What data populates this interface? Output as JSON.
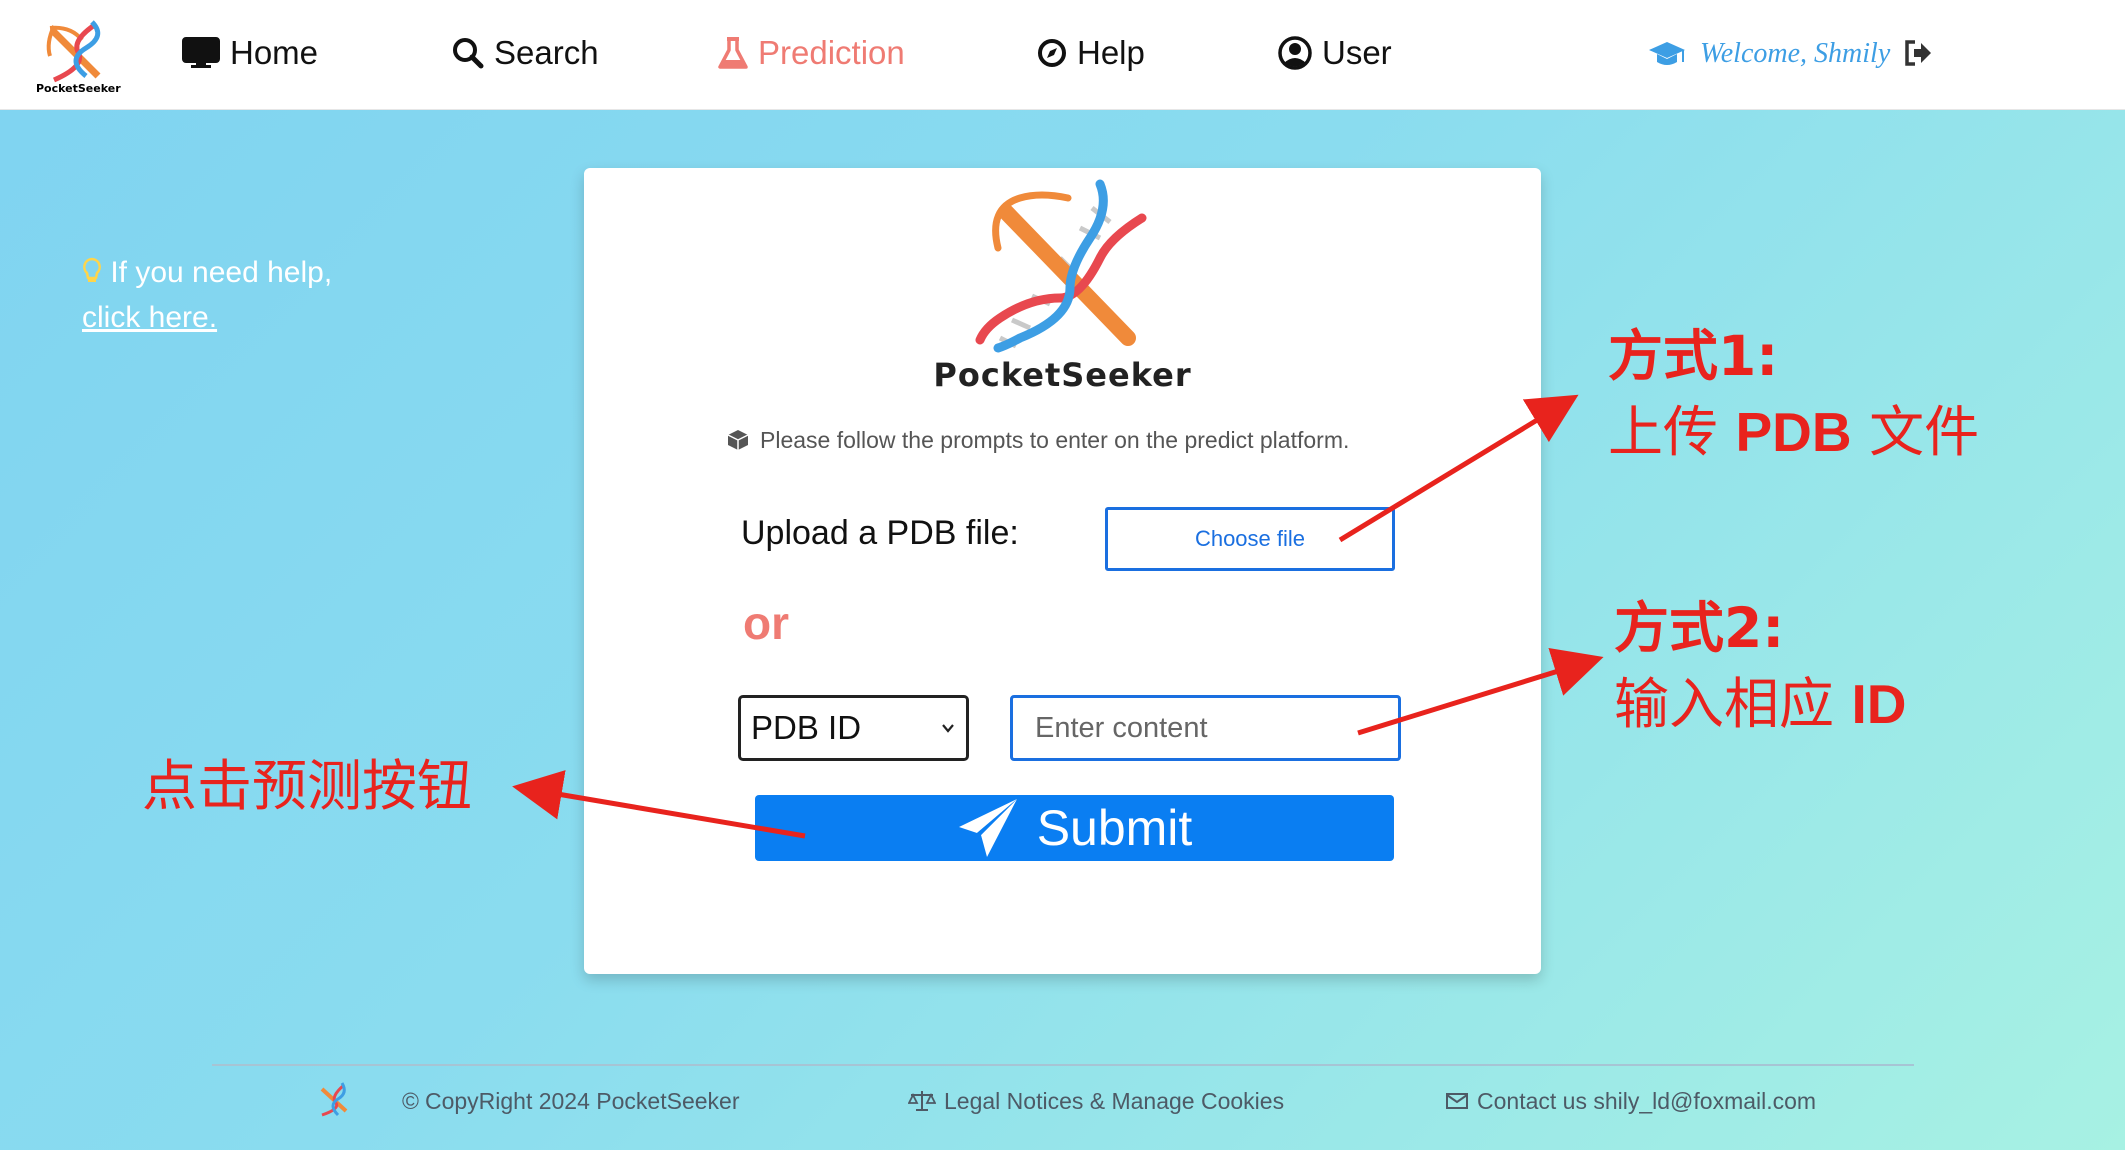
{
  "nav": {
    "logo_text": "PocketSeeker",
    "items": [
      {
        "label": "Home",
        "icon": "monitor-icon"
      },
      {
        "label": "Search",
        "icon": "search-icon"
      },
      {
        "label": "Prediction",
        "icon": "flask-icon",
        "active": true
      },
      {
        "label": "Help",
        "icon": "compass-icon"
      },
      {
        "label": "User",
        "icon": "user-circle-icon"
      }
    ],
    "welcome": "Welcome, Shmily",
    "accent_color": "#ef7b73",
    "link_color": "#3d9ee4"
  },
  "help_note": {
    "text": "If you need help,",
    "link": "click here."
  },
  "card": {
    "brand": "PocketSeeker",
    "prompt": "Please follow the prompts to enter on the predict platform.",
    "upload_label": "Upload a PDB file:",
    "choose_file": "Choose file",
    "or": "or",
    "select_value": "PDB ID",
    "input_placeholder": "Enter content",
    "submit": "Submit",
    "primary_color": "#0a7ef2"
  },
  "annotations": {
    "method1_title": "方式1:",
    "method1_line_cn1": "上传",
    "method1_line_en": "PDB",
    "method1_line_cn2": "文件",
    "method2_title": "方式2:",
    "method2_line_cn": "输入相应",
    "method2_line_en": "ID",
    "submit_hint": "点击预测按钮",
    "color": "#e8231d"
  },
  "footer": {
    "copyright": "CopyRight 2024 PocketSeeker",
    "legal": "Legal Notices & Manage Cookies",
    "contact": "Contact us shily_ld@foxmail.com"
  }
}
